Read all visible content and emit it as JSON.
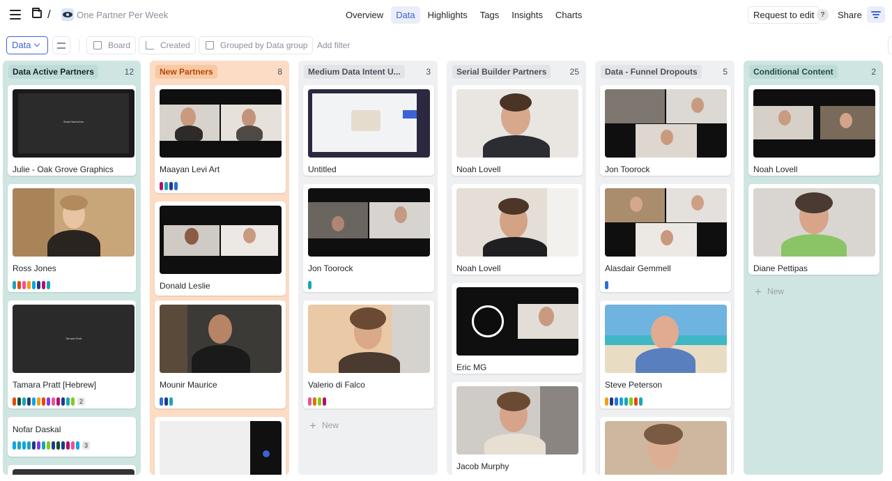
{
  "header": {
    "project_title": "One Partner Per Week",
    "nav_tabs": [
      {
        "label": "Overview",
        "active": false
      },
      {
        "label": "Data",
        "active": true
      },
      {
        "label": "Highlights",
        "active": false
      },
      {
        "label": "Tags",
        "active": false
      },
      {
        "label": "Insights",
        "active": false
      },
      {
        "label": "Charts",
        "active": false
      }
    ],
    "request_edit_label": "Request to edit",
    "help_label": "?",
    "share_label": "Share"
  },
  "toolbar": {
    "view_select": "Data",
    "board_label": "Board",
    "created_label": "Created",
    "grouped_label": "Grouped by Data group",
    "add_filter_label": "Add filter"
  },
  "tag_colors": [
    "#2a6fdb",
    "#18a7b5",
    "#b3106b",
    "#7c3aed",
    "#f59e0b",
    "#e8470f",
    "#84cc16",
    "#0f5132",
    "#1e3a8a",
    "#ef4f9a",
    "#0ea5e9",
    "#22c55e",
    "#d97706",
    "#6b1d4f"
  ],
  "columns": [
    {
      "title": "Data Active Partners",
      "count": "12",
      "header_color": "#bcdcd8",
      "bg_color": "#cfe5e2",
      "cards": [
        {
          "title": "Julie - Oak Grove Graphics",
          "thumb_text": "Shani Nachshon"
        },
        {
          "title": "Ross Jones"
        },
        {
          "title": "Tamara Pratt [Hebrew]",
          "thumb_text": "Tamara Pratt",
          "more": "2"
        },
        {
          "title": "Nofar Daskal",
          "more": "3"
        }
      ]
    },
    {
      "title": "New Partners",
      "count": "8",
      "header_color": "#f8c9a3",
      "bg_color": "#fcdcc4",
      "cards": [
        {
          "title": "Maayan Levi Art"
        },
        {
          "title": "Donald Leslie"
        },
        {
          "title": "Mounir Maurice"
        }
      ]
    },
    {
      "title": "Medium Data Intent U...",
      "count": "3",
      "header_color": "#e3e4e7",
      "bg_color": "#eff0f2",
      "cards": [
        {
          "title": "Untitled"
        },
        {
          "title": "Jon Toorock"
        },
        {
          "title": "Valerio di Falco"
        }
      ],
      "new_label": "New"
    },
    {
      "title": "Serial Builder Partners",
      "count": "25",
      "header_color": "#e3e4e7",
      "bg_color": "#eff0f2",
      "cards": [
        {
          "title": "Noah Lovell"
        },
        {
          "title": "Noah Lovell"
        },
        {
          "title": "Eric MG"
        },
        {
          "title": "Jacob Murphy"
        }
      ]
    },
    {
      "title": "Data - Funnel Dropouts",
      "count": "5",
      "header_color": "#e3e4e7",
      "bg_color": "#eff0f2",
      "cards": [
        {
          "title": "Jon Toorock"
        },
        {
          "title": "Alasdair Gemmell"
        },
        {
          "title": "Steve Peterson"
        }
      ]
    },
    {
      "title": "Conditional Content",
      "count": "2",
      "header_color": "#bcdcd8",
      "bg_color": "#cfe5e2",
      "cards": [
        {
          "title": "Noah Lovell"
        },
        {
          "title": "Diane Pettipas"
        }
      ],
      "new_label": "New"
    }
  ]
}
